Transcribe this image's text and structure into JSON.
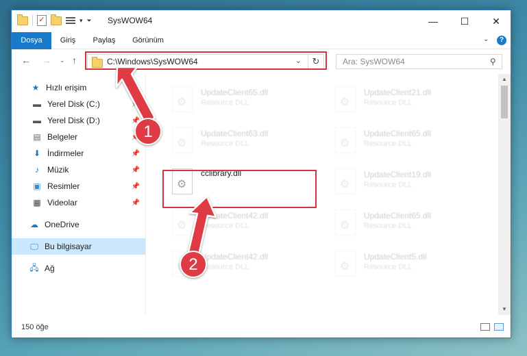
{
  "window": {
    "title": "SysWOW64"
  },
  "ribbon": {
    "tabs": [
      "Dosya",
      "Giriş",
      "Paylaş",
      "Görünüm"
    ]
  },
  "address": {
    "path": "C:\\Windows\\SysWOW64",
    "search_placeholder": "Ara: SysWOW64"
  },
  "nav": {
    "items": [
      {
        "label": "Hızlı erişim",
        "icon": "star-icon"
      },
      {
        "label": "Yerel Disk (C:)",
        "icon": "drive-icon"
      },
      {
        "label": "Yerel Disk (D:)",
        "icon": "drive-icon"
      },
      {
        "label": "Belgeler",
        "icon": "documents-icon"
      },
      {
        "label": "İndirmeler",
        "icon": "download-icon"
      },
      {
        "label": "Müzik",
        "icon": "music-icon"
      },
      {
        "label": "Resimler",
        "icon": "pictures-icon"
      },
      {
        "label": "Videolar",
        "icon": "videos-icon"
      },
      {
        "label": "OneDrive",
        "icon": "cloud-icon"
      },
      {
        "label": "Bu bilgisayar",
        "icon": "computer-icon"
      },
      {
        "label": "Ağ",
        "icon": "network-icon"
      }
    ]
  },
  "files": {
    "left": [
      {
        "name": "UpdateClient65.dll",
        "desc": "Resource DLL"
      },
      {
        "name": "UpdateClient63.dll",
        "desc": "Resource DLL"
      },
      {
        "name": "cclibrary.dll",
        "desc": ""
      },
      {
        "name": "UpdateClient42.dll",
        "desc": "Resource DLL"
      },
      {
        "name": "UpdateClient42.dll",
        "desc": "Resource DLL"
      }
    ],
    "right": [
      {
        "name": "UpdateClient21.dll",
        "desc": "Resource DLL"
      },
      {
        "name": "UpdateClient65.dll",
        "desc": "Resource DLL"
      },
      {
        "name": "UpdateClient19.dll",
        "desc": "Resource DLL"
      },
      {
        "name": "UpdateClient65.dll",
        "desc": "Resource DLL"
      },
      {
        "name": "UpdateClient5.dll",
        "desc": "Resource DLL"
      }
    ]
  },
  "status": {
    "item_count": "150 öğe"
  },
  "annotations": {
    "marker1": "1",
    "marker2": "2"
  },
  "colors": {
    "accent": "#1979ca",
    "highlight": "#d0363f",
    "marker": "#de3b44"
  }
}
